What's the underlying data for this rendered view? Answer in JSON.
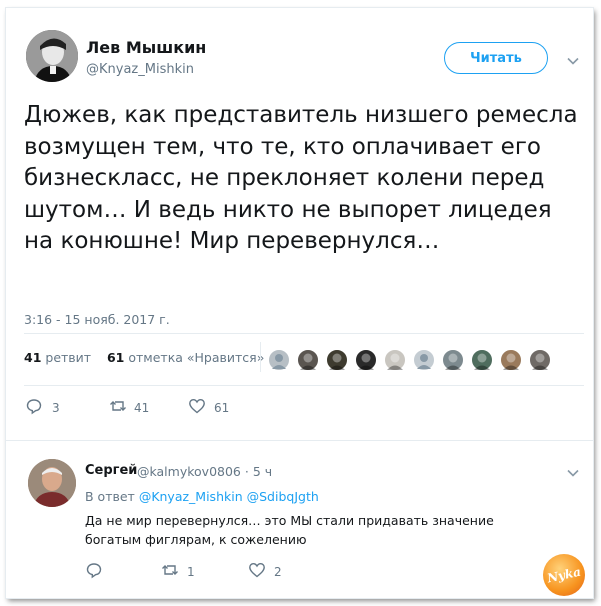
{
  "tweet": {
    "author_name": "Лев Мышкин",
    "author_handle": "@Knyaz_Mishkin",
    "follow_label": "Читать",
    "text": "Дюжев, как представитель низшего ремесла возмущен тем, что те, кто оплачивает его бизнескласс, не преклоняет колени перед шутом… И ведь никто не выпорет лицедея на конюшне! Мир перевернулся…",
    "timestamp": "3:16 - 15 нояб. 2017 г.",
    "retweets_count": "41",
    "retweets_label": "ретвит",
    "likes_count": "61",
    "likes_label": "отметка «Нравится»",
    "likers": [
      {
        "icon": "avatar-placeholder",
        "color": "#b7bfc5"
      },
      {
        "icon": "avatar-photo",
        "color": "#5a5550"
      },
      {
        "icon": "avatar-photo",
        "color": "#3e3b2f"
      },
      {
        "icon": "avatar-photo",
        "color": "#2a2a2a"
      },
      {
        "icon": "avatar-photo",
        "color": "#c9c6c0"
      },
      {
        "icon": "avatar-placeholder",
        "color": "#c4ccd2"
      },
      {
        "icon": "avatar-photo",
        "color": "#7d8a8f"
      },
      {
        "icon": "avatar-photo",
        "color": "#4f6d5e"
      },
      {
        "icon": "avatar-photo",
        "color": "#9a7a5c"
      },
      {
        "icon": "avatar-photo",
        "color": "#6f6a66"
      }
    ],
    "actions": {
      "reply_count": "3",
      "retweet_count": "41",
      "like_count": "61"
    }
  },
  "reply": {
    "author_name": "Сергей",
    "author_handle": "@kalmykov0806",
    "time_ago": "· 5 ч",
    "in_reply_prefix": "В ответ",
    "in_reply_to_1": "@Knyaz_Mishkin",
    "in_reply_to_2": "@SdibqJgth",
    "text": "Да не мир перевернулся… это МЫ стали придавать значение богатым фиглярам, к сожелению",
    "actions": {
      "reply_count": "",
      "retweet_count": "1",
      "like_count": "2"
    }
  },
  "watermark": {
    "text": "Nyka"
  },
  "colors": {
    "accent": "#1da1f2",
    "muted": "#657786",
    "text": "#14171a",
    "divider": "#e6ecf0"
  }
}
